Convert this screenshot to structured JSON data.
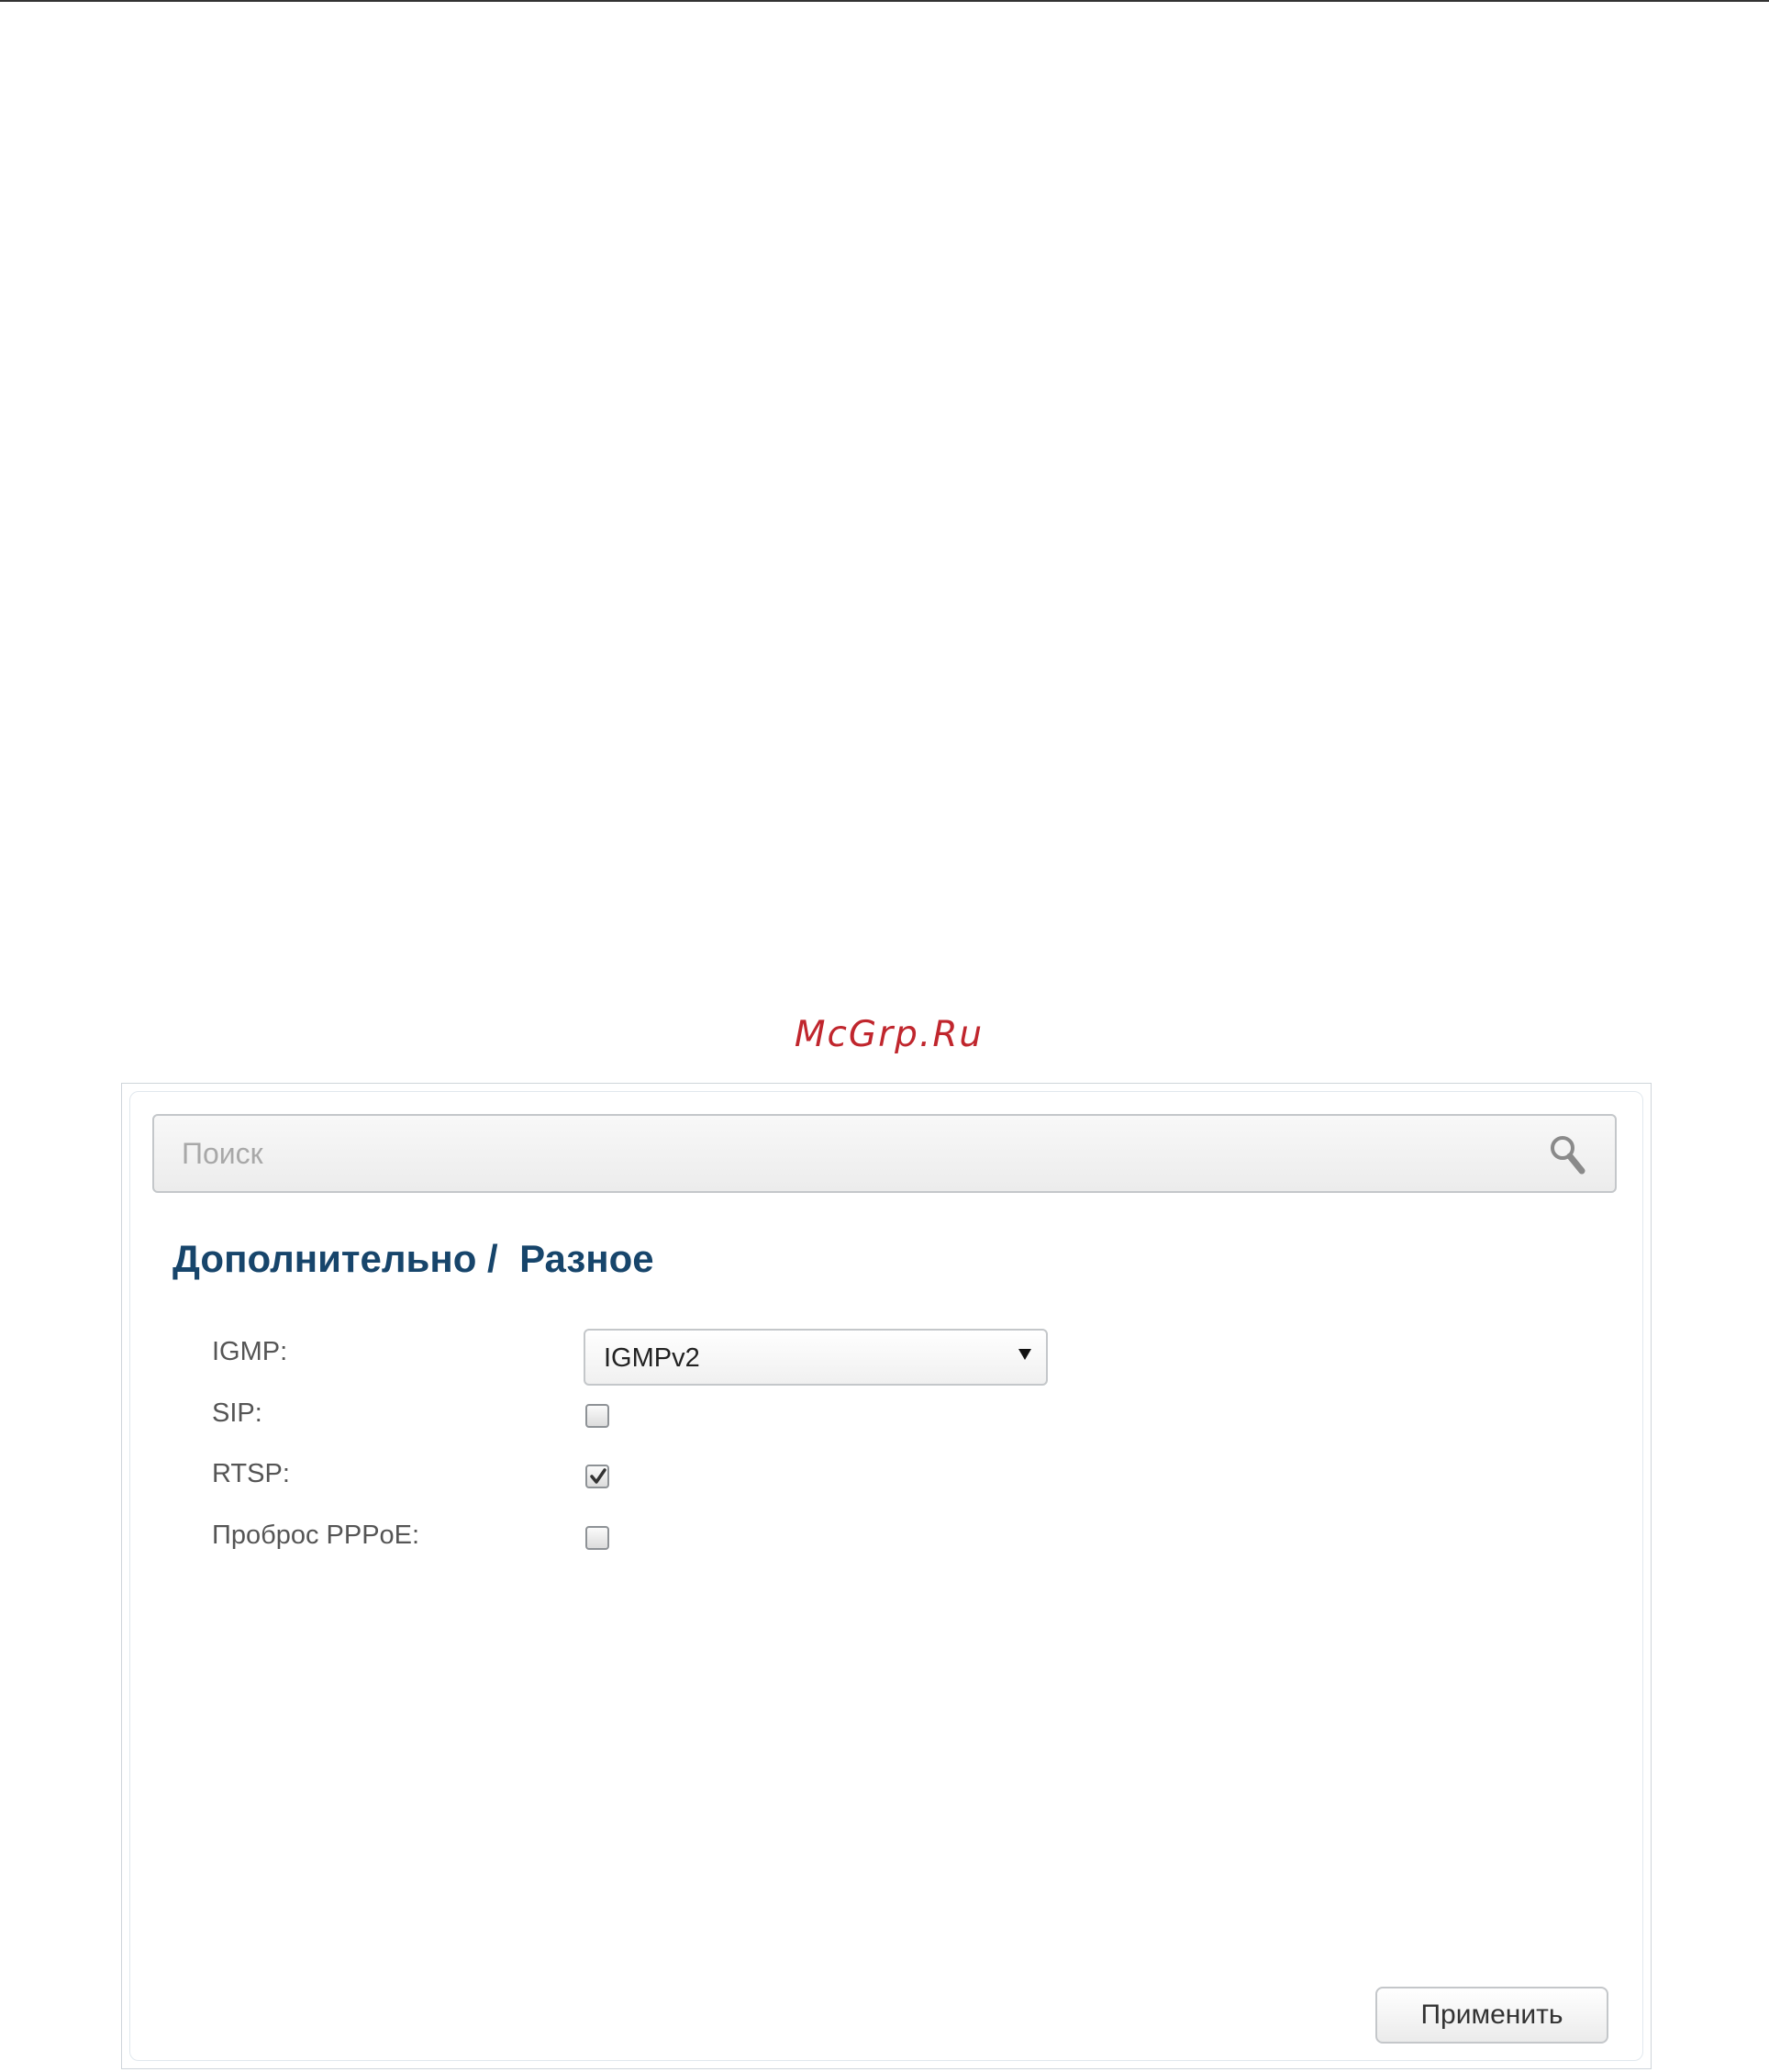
{
  "watermark": "McGrp.Ru",
  "search": {
    "placeholder": "Поиск",
    "icon": "magnifier-icon"
  },
  "breadcrumb": {
    "section": "Дополнительно",
    "separator": " /  ",
    "page": "Разное"
  },
  "form": {
    "igmp": {
      "label": "IGMP:",
      "selected": "IGMPv2"
    },
    "sip": {
      "label": "SIP:",
      "checked": false
    },
    "rtsp": {
      "label": "RTSP:",
      "checked": true
    },
    "pppoe_passthrough": {
      "label": "Проброс PPPoE:",
      "checked": false
    }
  },
  "actions": {
    "apply_label": "Применить"
  },
  "colors": {
    "title": "#17456b",
    "watermark": "#c0262d",
    "label": "#555555"
  }
}
